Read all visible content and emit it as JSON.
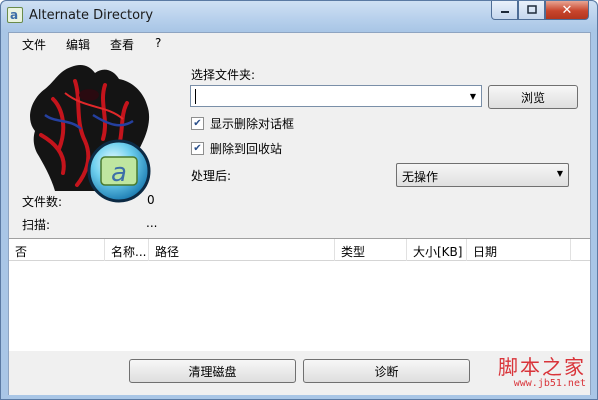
{
  "window": {
    "title": "Alternate Directory",
    "icon": "app-a-icon",
    "controls": {
      "minimize": "▭",
      "maximize": "□",
      "close": "✕"
    }
  },
  "menu": [
    "文件",
    "编辑",
    "查看",
    "?"
  ],
  "logo": {
    "icon": "red-figure-logo",
    "letter": "a"
  },
  "stats": {
    "file_count_label": "文件数:",
    "file_count_value": "0",
    "scan_label": "扫描:",
    "scan_value": "..."
  },
  "folder": {
    "label": "选择文件夹:",
    "value": "",
    "browse_button": "浏览"
  },
  "options": {
    "show_delete_dialog": {
      "label": "显示删除对话框",
      "checked": true
    },
    "delete_to_recycle": {
      "label": "删除到回收站",
      "checked": true
    }
  },
  "after": {
    "label": "处理后:",
    "selected": "无操作"
  },
  "list": {
    "columns": [
      "否",
      "名称...",
      "路径",
      "类型",
      "大小[KB]",
      "日期"
    ],
    "rows": []
  },
  "buttons": {
    "clean_disk": "清理磁盘",
    "diagnose": "诊断"
  },
  "watermark": {
    "title": "脚本之家",
    "url": "www.jb51.net"
  },
  "colors": {
    "accent": "#3d6fa8",
    "watermark": "#d9343a",
    "close_button": "#c8452c"
  }
}
